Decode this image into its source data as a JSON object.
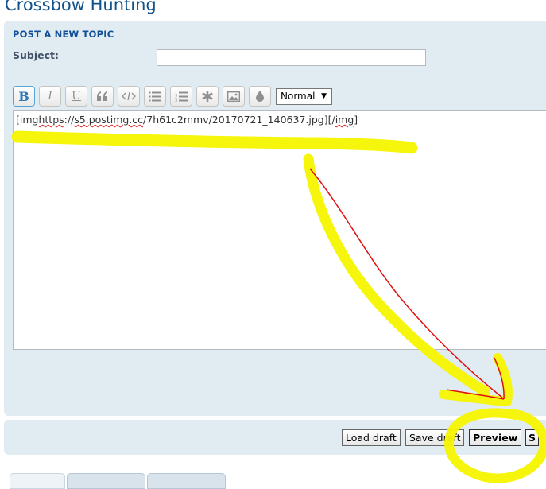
{
  "forum": {
    "title": "Crossbow Hunting"
  },
  "post_form": {
    "heading": "POST A NEW TOPIC",
    "subject_label": "Subject:",
    "subject_value": "",
    "toolbar": {
      "bold_label": "B",
      "italic_label": "I",
      "underline_label": "U",
      "font_size_selected": "Normal",
      "font_size_arrow": "▼"
    },
    "message": {
      "parts": [
        "[img",
        "https",
        "://",
        "s5.postimg.cc",
        "/7h61c2mmv/20170721_140637.jpg][/",
        "img",
        "]"
      ]
    }
  },
  "actions": {
    "load_draft": "Load draft",
    "save_draft": "Save draft",
    "preview": "Preview",
    "submit_partial": "S"
  },
  "annotation": {
    "highlight_color": "#f5f500",
    "pen_color": "#e01010"
  }
}
